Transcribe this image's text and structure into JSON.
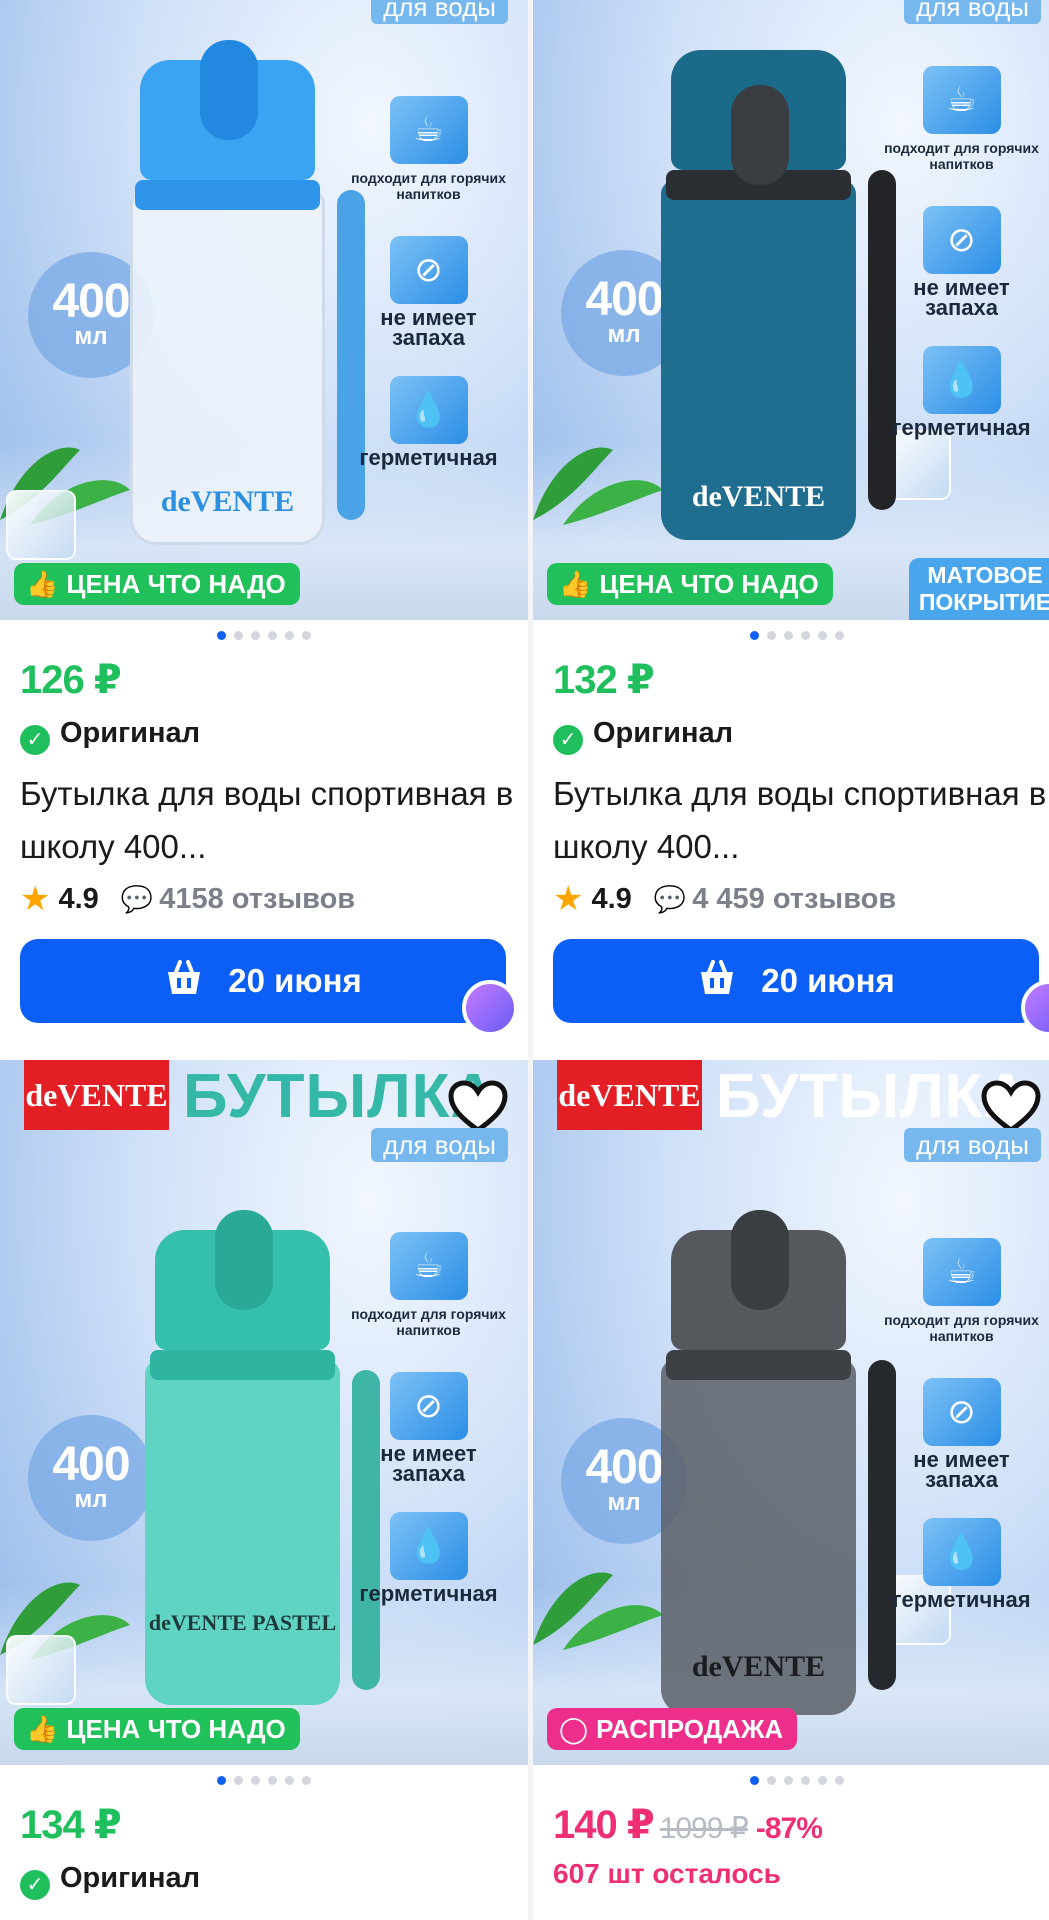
{
  "products": [
    {
      "top_badge": "для воды",
      "volume": {
        "number": "400",
        "unit": "мл"
      },
      "features": [
        "подходит для горячих напитков",
        "не имеет запаха",
        "герметичная"
      ],
      "bottle_logo": "deVENTE",
      "promo": "ЦЕНА ЧТО НАДО",
      "price": "126 ₽",
      "original_label": "Оригинал",
      "title": "Бутылка для воды спортивная в школу 400...",
      "rating": "4.9",
      "reviews": "4158 отзывов",
      "delivery": "20 июня",
      "colors": {
        "cap": "#3aa4f2",
        "body": "#e4eef8",
        "strap": "#4aa3e6"
      }
    },
    {
      "top_badge": "для воды",
      "volume": {
        "number": "400",
        "unit": "мл"
      },
      "features": [
        "подходит для горячих напитков",
        "не имеет запаха",
        "герметичная"
      ],
      "bottle_logo": "deVENTE",
      "promo": "ЦЕНА ЧТО НАДО",
      "corner_label": "МАТОВОЕ ПОКРЫТИЕ",
      "price": "132 ₽",
      "original_label": "Оригинал",
      "title": "Бутылка для воды спортивная в школу 400...",
      "rating": "4.9",
      "reviews": "4 459 отзывов",
      "delivery": "20 июня",
      "colors": {
        "cap": "#3a3d42",
        "body": "#1f6e90",
        "strap": "#222428"
      }
    },
    {
      "header_logo": "deVENTE",
      "header_title": "БУТЫЛКА",
      "top_badge": "для воды",
      "volume": {
        "number": "400",
        "unit": "мл"
      },
      "features": [
        "подходит для горячих напитков",
        "не имеет запаха",
        "герметичная"
      ],
      "bottle_logo": "deVENTE PASTEL",
      "promo": "ЦЕНА ЧТО НАДО",
      "price": "134 ₽",
      "original_label": "Оригинал",
      "colors": {
        "cap": "#35c0ae",
        "body": "#5fd4c3",
        "strap": "#3fb5a8",
        "title": "#35b8a8"
      }
    },
    {
      "header_logo": "deVENTE",
      "header_title": "БУТЫЛКА",
      "top_badge": "для воды",
      "volume": {
        "number": "400",
        "unit": "мл"
      },
      "features": [
        "подходит для горячих напитков",
        "не имеет запаха",
        "герметичная"
      ],
      "bottle_logo": "deVENTE",
      "promo": "РАСПРОДАЖА",
      "price": "140 ₽",
      "old_price": "1099 ₽",
      "discount": "-87%",
      "stock_left": "607 шт осталось",
      "colors": {
        "cap": "#55585d",
        "body": "#6c7076",
        "strap": "#25282c",
        "title": "#ffffff"
      }
    }
  ],
  "icons": {
    "hot": "cup-icon",
    "odor": "no-odor-icon",
    "seal": "drop-icon",
    "favorite": "heart-icon",
    "cart": "basket-icon",
    "check": "check-icon",
    "star": "star-icon",
    "reviews": "comment-icon",
    "promo_good": "thumbs-up-icon",
    "promo_sale": "sale-ring-icon",
    "premium": "crown-icon"
  }
}
